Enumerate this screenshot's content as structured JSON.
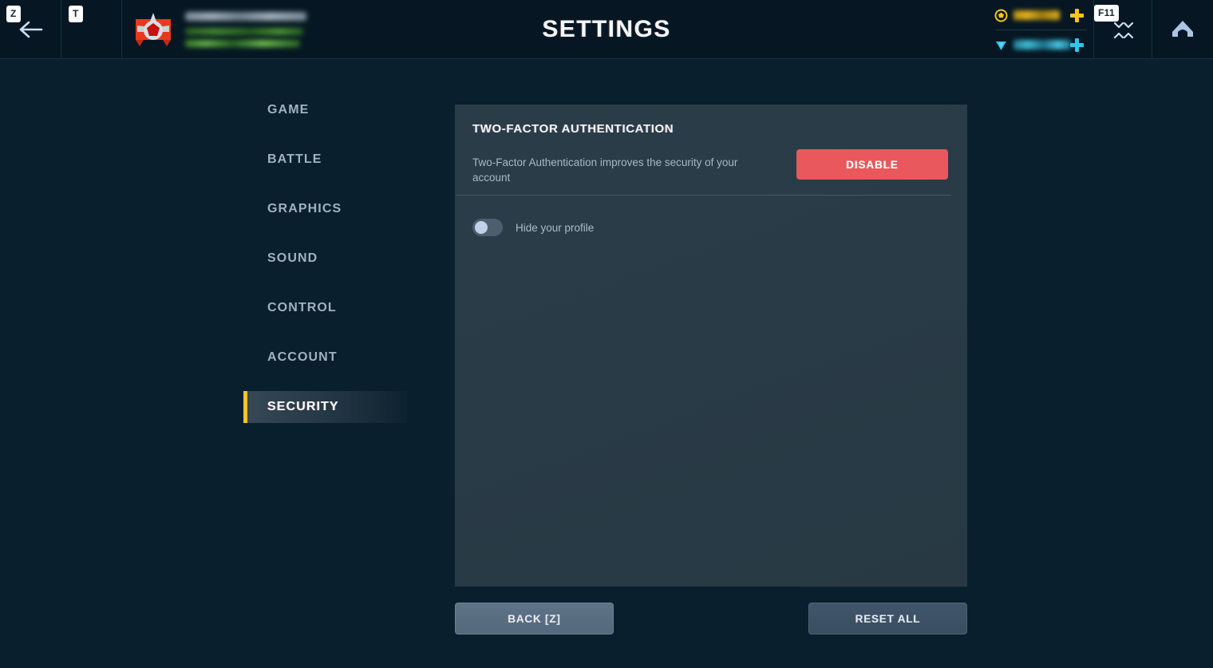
{
  "header": {
    "title": "SETTINGS",
    "back_key": "Z",
    "back_icon": "arrow-left-icon",
    "menu_key": "T",
    "menu_icon": "three-dots-icon",
    "fullscreen_key": "F11",
    "fullscreen_icon": "fullscreen-collapse-icon",
    "home_icon": "home-icon",
    "player": {
      "emblem_icon": "rank-emblem-icon",
      "name": "",
      "progress_line_1": "",
      "progress_line_2": ""
    },
    "currency": [
      {
        "icon": "gold-coin-icon",
        "amount": "",
        "add_label": "+",
        "color": "#f5c518"
      },
      {
        "icon": "gem-icon",
        "amount": "",
        "add_label": "+",
        "color": "#35c4e8"
      }
    ]
  },
  "sidebar": {
    "items": [
      {
        "label": "GAME",
        "active": false
      },
      {
        "label": "BATTLE",
        "active": false
      },
      {
        "label": "GRAPHICS",
        "active": false
      },
      {
        "label": "SOUND",
        "active": false
      },
      {
        "label": "CONTROL",
        "active": false
      },
      {
        "label": "ACCOUNT",
        "active": false
      },
      {
        "label": "SECURITY",
        "active": true
      }
    ],
    "active_accent_color": "#f7c325"
  },
  "panel": {
    "section_title": "TWO-FACTOR AUTHENTICATION",
    "description": "Two-Factor Authentication improves the security of your account",
    "disable_button": "DISABLE",
    "disable_button_color": "#e8585c",
    "toggle": {
      "label": "Hide your profile",
      "state": "off"
    }
  },
  "footer": {
    "back_label": "BACK [Z]",
    "reset_label": "RESET ALL"
  }
}
